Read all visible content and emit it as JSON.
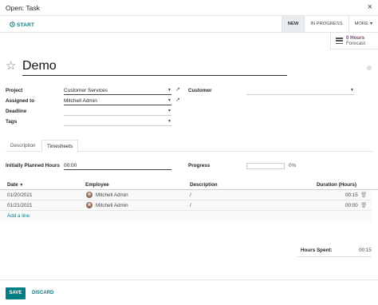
{
  "dialog": {
    "title": "Open: Task",
    "close_glyph": "×"
  },
  "statusbar": {
    "start_label": "START",
    "stages": [
      {
        "label": "NEW",
        "active": true
      },
      {
        "label": "IN PROGRESS",
        "active": false
      },
      {
        "label": "MORE",
        "active": false
      }
    ],
    "more_chevron": "▾"
  },
  "smart_button": {
    "value": "0 Hours",
    "label": "Forecast",
    "icon": "tasks-icon"
  },
  "task": {
    "favorite_glyph": "☆",
    "name": "Demo"
  },
  "fields": {
    "project": {
      "label": "Project",
      "value": "Customer Services"
    },
    "assigned_to": {
      "label": "Assigned to",
      "value": "Mitchell Admin"
    },
    "deadline": {
      "label": "Deadline",
      "value": ""
    },
    "tags": {
      "label": "Tags",
      "value": ""
    },
    "customer": {
      "label": "Customer",
      "value": ""
    }
  },
  "tabs": [
    {
      "label": "Description",
      "active": false
    },
    {
      "label": "Timesheets",
      "active": true
    }
  ],
  "timesheets": {
    "planned_label": "Initially Planned Hours",
    "planned_value": "00:00",
    "progress_label": "Progress",
    "progress_fraction": 0,
    "progress_text": "0%",
    "columns": {
      "date": "Date",
      "sort_glyph": "▼",
      "employee": "Employee",
      "description": "Description",
      "duration": "Duration (Hours)"
    },
    "rows": [
      {
        "date": "01/20/2021",
        "employee": "Mitchell Admin",
        "description": "/",
        "duration": "00:15"
      },
      {
        "date": "01/21/2021",
        "employee": "Mitchell Admin",
        "description": "/",
        "duration": "00:00"
      }
    ],
    "add_line_label": "Add a line",
    "hours_spent_label": "Hours Spent:",
    "hours_spent_value": "00:15"
  },
  "footer": {
    "save_label": "SAVE",
    "discard_label": "DISCARD"
  },
  "colors": {
    "accent": "#017e84",
    "brand": "#714b67"
  }
}
